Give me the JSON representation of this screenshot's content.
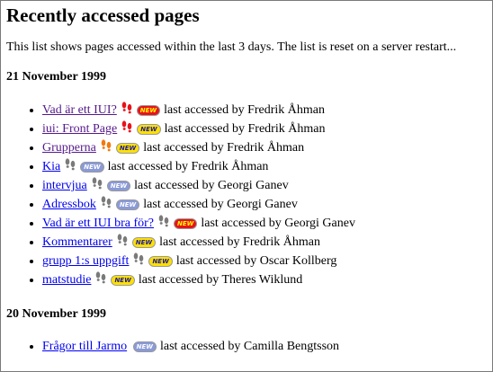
{
  "title": "Recently accessed pages",
  "intro": "This list shows pages accessed within the last 3 days. The list is reset on a server restart...",
  "days": [
    {
      "date": "21 November 1999",
      "entries": [
        {
          "link": "Vad är ett IUI?",
          "visited": true,
          "heat": "hot",
          "badge": "NEW",
          "badge_color": "red",
          "text": "last accessed by Fredrik Åhman"
        },
        {
          "link": "iui: Front Page",
          "visited": true,
          "heat": "hot",
          "badge": "NEW",
          "badge_color": "yellow",
          "text": "last accessed by Fredrik Åhman"
        },
        {
          "link": "Grupperna",
          "visited": true,
          "heat": "warm",
          "badge": "NEW",
          "badge_color": "yellow",
          "text": "last accessed by Fredrik Åhman"
        },
        {
          "link": "Kia",
          "visited": false,
          "heat": "cool",
          "badge": "NEW",
          "badge_color": "blue",
          "text": "last accessed by Fredrik Åhman"
        },
        {
          "link": "intervjua",
          "visited": false,
          "heat": "cool",
          "badge": "NEW",
          "badge_color": "blue",
          "text": "last accessed by Georgi Ganev"
        },
        {
          "link": "Adressbok",
          "visited": false,
          "heat": "cool",
          "badge": "NEW",
          "badge_color": "blue",
          "text": "last accessed by Georgi Ganev"
        },
        {
          "link": "Vad är ett IUI bra för?",
          "visited": false,
          "heat": "cool",
          "badge": "NEW",
          "badge_color": "red",
          "text": "last accessed by Georgi Ganev"
        },
        {
          "link": "Kommentarer",
          "visited": false,
          "heat": "cool",
          "badge": "NEW",
          "badge_color": "yellow",
          "text": "last accessed by Fredrik Åhman"
        },
        {
          "link": "grupp 1:s uppgift",
          "visited": false,
          "heat": "cool",
          "badge": "NEW",
          "badge_color": "yellow",
          "text": "last accessed by Oscar Kollberg"
        },
        {
          "link": "matstudie",
          "visited": false,
          "heat": "cool",
          "badge": "NEW",
          "badge_color": "yellow",
          "text": "last accessed by Theres Wiklund"
        }
      ]
    },
    {
      "date": "20 November 1999",
      "entries": [
        {
          "link": "Frågor till Jarmo",
          "visited": false,
          "heat": "none",
          "badge": "NEW",
          "badge_color": "blue",
          "text": "last accessed by Camilla Bengtsson"
        }
      ]
    }
  ],
  "colors": {
    "link": "#0000ee",
    "visited": "#551a8b",
    "feet_hot": "#e8121a",
    "feet_warm": "#f07a10",
    "feet_cool": "#7a7a7a",
    "badge_red_bg": "#e8121a",
    "badge_red_text": "#ffff00",
    "badge_yellow_bg": "#ffe000",
    "badge_yellow_text": "#1a1aa0",
    "badge_blue_bg": "#8a9ad8",
    "badge_blue_text": "#ffffff"
  },
  "icons": {
    "feet": "footprints-icon",
    "badge": "new-badge-icon"
  }
}
